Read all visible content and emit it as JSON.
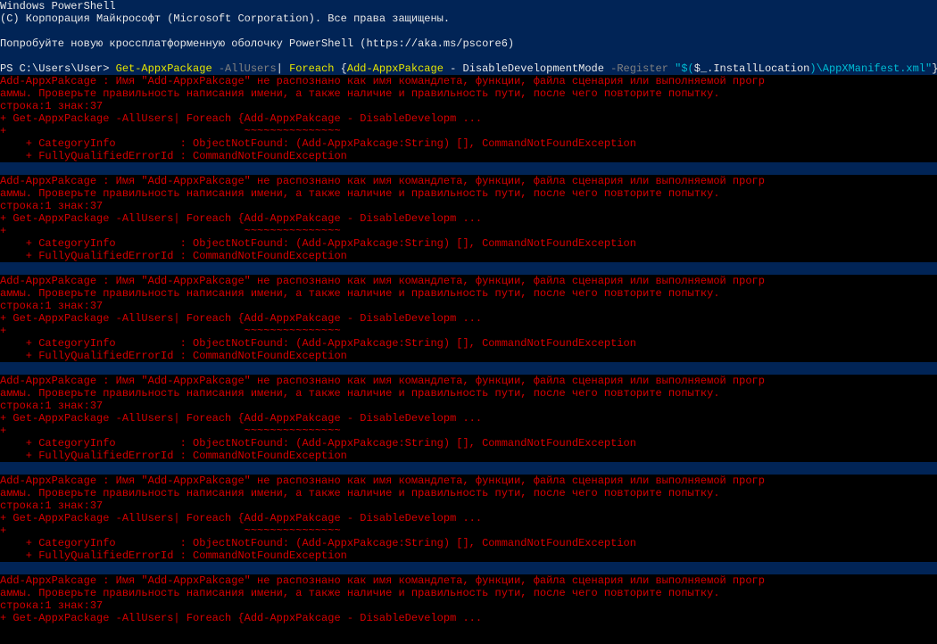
{
  "header": {
    "title": "Windows PowerShell",
    "copyright": "(C) Корпорация Майкрософт (Microsoft Corporation). Все права защищены.",
    "trynew": "Попробуйте новую кроссплатформенную оболочку PowerShell (https://aka.ms/pscore6)"
  },
  "prompt": {
    "ps": "PS C:\\Users\\User> ",
    "cmd_yellow1": "Get-AppxPackage ",
    "cmd_gray1": "-AllUsers",
    "cmd_white1": "| ",
    "cmd_yellow2": "Foreach ",
    "cmd_white2": "{",
    "cmd_yellow3": "Add-AppxPakcage ",
    "cmd_white3": "- DisableDevelopmentMode ",
    "cmd_gray2": "-Register ",
    "cmd_cyan1": "\"$(",
    "cmd_white4": "$_.InstallLocation",
    "cmd_cyan2": ")\\AppXManifest.xml\"",
    "cmd_white5": "}"
  },
  "error_block": {
    "l1": "Add-AppxPakcage : Имя \"Add-AppxPakcage\" не распознано как имя командлета, функции, файла сценария или выполняемой прогр",
    "l2": "аммы. Проверьте правильность написания имени, а также наличие и правильность пути, после чего повторите попытку.",
    "l3": "строка:1 знак:37",
    "l4": "+ Get-AppxPackage -AllUsers| Foreach {Add-AppxPakcage - DisableDevelopm ...",
    "l5": "+                                     ~~~~~~~~~~~~~~~",
    "l6": "    + CategoryInfo          : ObjectNotFound: (Add-AppxPakcage:String) [], CommandNotFoundException",
    "l7": "    + FullyQualifiedErrorId : CommandNotFoundException"
  }
}
